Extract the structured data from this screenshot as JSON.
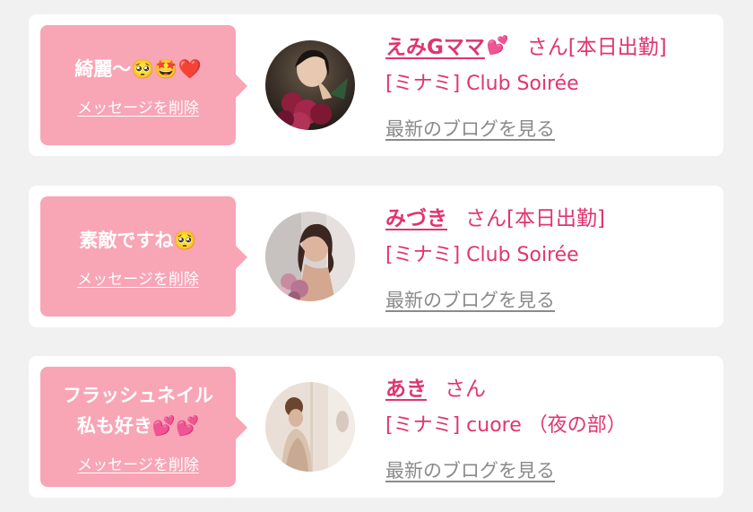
{
  "colors": {
    "background": "#f1f1f1",
    "card": "#ffffff",
    "bubble": "#f8a5b6",
    "accent": "#e0356e",
    "link_gray": "#8a8a8a"
  },
  "messages": [
    {
      "bubble_text": "綺麗〜🥺🤩❤️",
      "delete_label": "メッセージを削除",
      "name": "えみGママ",
      "name_icon": "💕",
      "name_suffix": "さん[本日出勤]",
      "shop": "[ミナミ] Club Soirée",
      "blog_link": "最新のブログを見る",
      "avatar_icon": "woman-with-roses-photo"
    },
    {
      "bubble_text": "素敵ですね🥺",
      "delete_label": "メッセージを削除",
      "name": "みづき",
      "name_icon": "",
      "name_suffix": "さん[本日出勤]",
      "shop": "[ミナミ] Club Soirée",
      "blog_link": "最新のブログを見る",
      "avatar_icon": "woman-with-flowers-photo"
    },
    {
      "bubble_text": "フラッシュネイル\n私も好き💕💕",
      "delete_label": "メッセージを削除",
      "name": "あき",
      "name_icon": "",
      "name_suffix": "さん",
      "shop": "[ミナミ] cuore （夜の部）",
      "blog_link": "最新のブログを見る",
      "avatar_icon": "woman-in-dress-photo"
    }
  ]
}
